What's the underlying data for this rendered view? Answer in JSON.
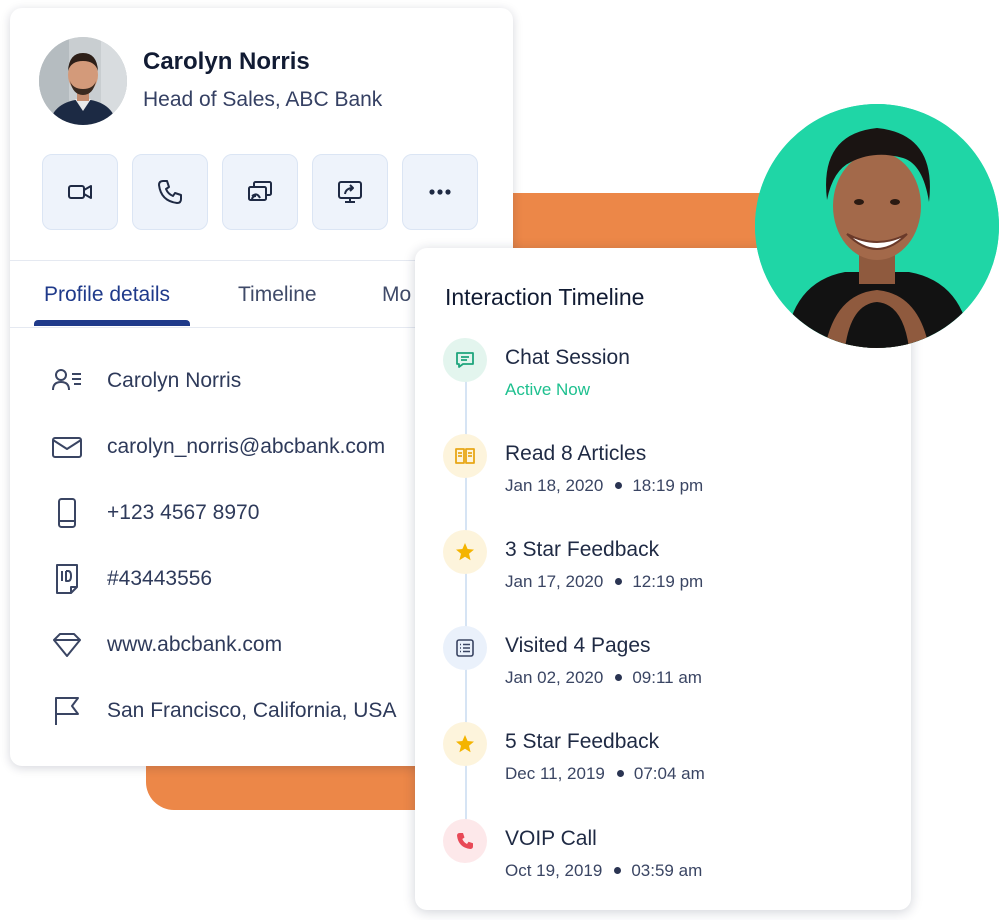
{
  "profile": {
    "name": "Carolyn Norris",
    "role": "Head of Sales, ABC Bank",
    "actions": [
      {
        "icon": "video-icon"
      },
      {
        "icon": "phone-icon"
      },
      {
        "icon": "cast-icon"
      },
      {
        "icon": "screen-share-icon"
      },
      {
        "icon": "more-icon"
      }
    ],
    "tabs": [
      "Profile details",
      "Timeline",
      "Mo"
    ],
    "details": [
      {
        "icon": "contact-icon",
        "text": "Carolyn Norris"
      },
      {
        "icon": "mail-icon",
        "text": "carolyn_norris@abcbank.com"
      },
      {
        "icon": "mobile-icon",
        "text": "+123 4567 8970"
      },
      {
        "icon": "id-icon",
        "text": "#43443556"
      },
      {
        "icon": "diamond-icon",
        "text": "www.abcbank.com"
      },
      {
        "icon": "flag-icon",
        "text": "San Francisco, California, USA"
      }
    ]
  },
  "timeline": {
    "title": "Interaction Timeline",
    "items": [
      {
        "icon": "chat-icon",
        "label": "Chat Session",
        "status": "Active Now"
      },
      {
        "icon": "book-icon",
        "label": "Read 8 Articles",
        "date": "Jan 18, 2020",
        "time": "18:19 pm"
      },
      {
        "icon": "star-icon",
        "label": "3 Star Feedback",
        "date": "Jan 17, 2020",
        "time": "12:19 pm"
      },
      {
        "icon": "list-icon",
        "label": "Visited 4 Pages",
        "date": "Jan 02, 2020",
        "time": "09:11 am"
      },
      {
        "icon": "star-icon",
        "label": "5 Star Feedback",
        "date": "Dec 11, 2019",
        "time": "07:04 am"
      },
      {
        "icon": "phone-icon",
        "label": "VOIP Call",
        "date": "Oct 19, 2019",
        "time": "03:59 am"
      }
    ]
  },
  "colors": {
    "accent_orange": "#ec8748",
    "active_green": "#1ec08f",
    "tab_active": "#1f3a8a",
    "avatar_bg_green": "#1fd6a6"
  }
}
